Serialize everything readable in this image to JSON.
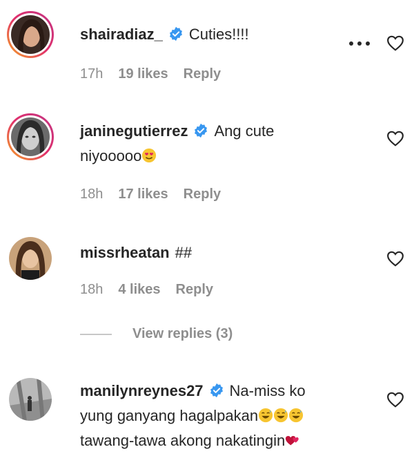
{
  "comments": [
    {
      "username": "shairadiaz_",
      "verified": true,
      "text": "Cuties!!!!",
      "time": "17h",
      "likes": "19 likes",
      "reply": "Reply"
    },
    {
      "username": "janinegutierrez",
      "verified": true,
      "text_line1": "Ang cute",
      "text_line2": "niyooooo",
      "time": "18h",
      "likes": "17 likes",
      "reply": "Reply"
    },
    {
      "username": "missrheatan",
      "verified": false,
      "text": "##",
      "time": "18h",
      "likes": "4 likes",
      "reply": "Reply"
    },
    {
      "username": "manilynreynes27",
      "verified": true,
      "text_line1": "Na-miss ko",
      "text_line2": "yung ganyang hagalpakan",
      "text_line3": "tawang-tawa akong nakatingin"
    }
  ],
  "view_replies": "View replies (3)",
  "colors": {
    "text": "#262626",
    "muted": "#8e8e8e",
    "verified": "#3897f0",
    "ring_start": "#f5a623",
    "ring_end": "#c13584"
  },
  "icons": [
    "verified-badge-icon",
    "heart-outline-icon",
    "more-options-icon",
    "grinning-sweat-emoji",
    "heart-eyes-emoji",
    "two-hearts-emoji"
  ]
}
